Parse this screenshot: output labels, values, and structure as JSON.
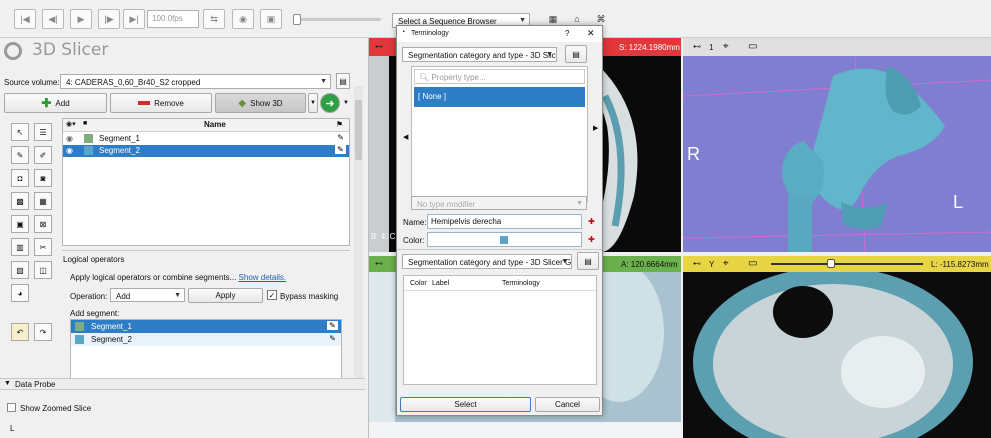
{
  "toolbar": {
    "fps_value": "100.0fps",
    "sequence_browser": "Select a Sequence Browser"
  },
  "app": {
    "title": "3D Slicer"
  },
  "segmentation": {
    "source_volume_label": "Source volume:",
    "source_volume_value": "4: CADERAS_0,60_Br40_S2 cropped",
    "add_label": "Add",
    "remove_label": "Remove",
    "show3d_label": "Show 3D",
    "table_header_name": "Name",
    "segments": [
      {
        "name": "Segment_1",
        "color": "#80ad7e",
        "selected": false
      },
      {
        "name": "Segment_2",
        "color": "#5aa6c6",
        "selected": true
      }
    ]
  },
  "logical": {
    "title": "Logical operators",
    "description": "Apply logical operators or combine segments...",
    "show_details": "Show details.",
    "operation_label": "Operation:",
    "operation_value": "Add",
    "apply_label": "Apply",
    "bypass_label": "Bypass masking",
    "add_segment_label": "Add segment:",
    "segments": [
      {
        "name": "Segment_1",
        "color": "#80ad7e",
        "selected": true
      },
      {
        "name": "Segment_2",
        "color": "#5aa6c6",
        "selected": false
      }
    ]
  },
  "data_probe": {
    "title": "Data Probe",
    "show_zoomed": "Show Zoomed Slice",
    "l_label": "L"
  },
  "views": {
    "red_offset": "S: 1224.1980mm",
    "green_offset": "A: 120.6664mm",
    "yellow_offset": "L: -115.8273mm",
    "three_d_index": "1",
    "yellow_axis": "Y",
    "label_r": "R",
    "label_l": "L",
    "red_corner_text": "B: 4: C"
  },
  "terminology": {
    "title": "Terminology",
    "help": "?",
    "category_combo": "Segmentation category and type - 3D Slice",
    "property_placeholder": "Property type...",
    "none_item": "[ None ]",
    "type_modifier": "No type modifier",
    "name_label": "Name:",
    "name_value": "Hemipelvis derecha",
    "color_label": "Color:",
    "color_value": "#5aa6c6",
    "category_combo2": "Segmentation category and type - 3D Slicer Ge",
    "table_headers": [
      "Color",
      "Label",
      "Terminology"
    ],
    "select_label": "Select",
    "cancel_label": "Cancel"
  },
  "colors": {
    "selection": "#2e7ec7",
    "red_slice": "#e2373b",
    "green_slice": "#6ab04c",
    "yellow_slice": "#e8d545",
    "three_d_bg": "#7f7ed0",
    "bone": "#61b6cc"
  }
}
